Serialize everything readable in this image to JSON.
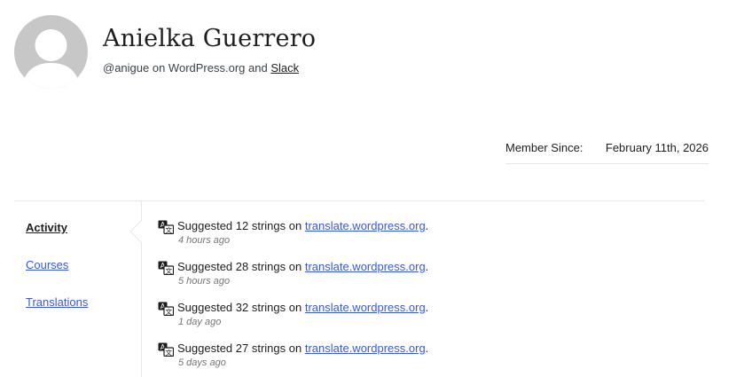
{
  "profile": {
    "name": "Anielka Guerrero",
    "handle": "@anigue",
    "handle_suffix": " on WordPress.org and ",
    "slack_link": "Slack"
  },
  "member_since": {
    "label": "Member Since:",
    "value": "February 11th, 2026"
  },
  "nav": {
    "items": [
      {
        "label": "Activity",
        "active": true
      },
      {
        "label": "Courses",
        "active": false
      },
      {
        "label": "Translations",
        "active": false
      }
    ]
  },
  "activity": [
    {
      "icon": "translate-icon",
      "text": "Suggested 12 strings on ",
      "link": "translate.wordpress.org",
      "end": ".",
      "time": "4 hours ago"
    },
    {
      "icon": "translate-icon",
      "text": "Suggested 28 strings on ",
      "link": "translate.wordpress.org",
      "end": ".",
      "time": "5 hours ago"
    },
    {
      "icon": "translate-icon",
      "text": "Suggested 32 strings on ",
      "link": "translate.wordpress.org",
      "end": ".",
      "time": "1 day ago"
    },
    {
      "icon": "translate-icon",
      "text": "Suggested 27 strings on ",
      "link": "translate.wordpress.org",
      "end": ".",
      "time": "5 days ago"
    }
  ],
  "colors": {
    "link": "#3858e9",
    "text": "#1e1e1e",
    "muted": "#757575",
    "border": "#e6e6e6",
    "avatar": "#c7c7c7"
  }
}
